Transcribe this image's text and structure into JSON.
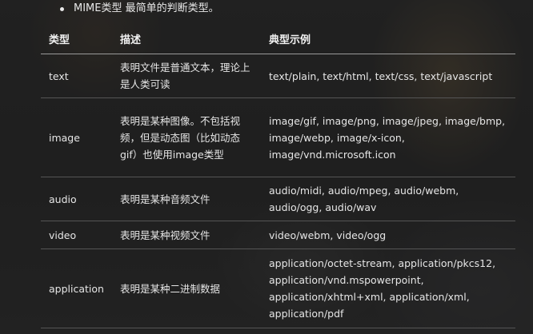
{
  "bullet": {
    "text": "MIME类型 最简单的判断类型。"
  },
  "table": {
    "headers": [
      "类型",
      "描述",
      "典型示例"
    ],
    "rows": [
      {
        "type": "text",
        "description": "表明文件是普通文本，理论上是人类可读",
        "examples": "text/plain, text/html, text/css, text/javascript"
      },
      {
        "type": "image",
        "description": "表明是某种图像。不包括视频，但是动态图（比如动态gif）也使用image类型",
        "examples": "image/gif, image/png, image/jpeg, image/bmp, image/webp, image/x-icon, image/vnd.microsoft.icon"
      },
      {
        "type": "audio",
        "description": "表明是某种音频文件",
        "examples": "audio/midi, audio/mpeg, audio/webm, audio/ogg, audio/wav"
      },
      {
        "type": "video",
        "description": "表明是某种视频文件",
        "examples": "video/webm, video/ogg"
      },
      {
        "type": "application",
        "description": "表明是某种二进制数据",
        "examples": "application/octet-stream, application/pkcs12, application/vnd.mspowerpoint, application/xhtml+xml, application/xml, application/pdf"
      }
    ]
  }
}
